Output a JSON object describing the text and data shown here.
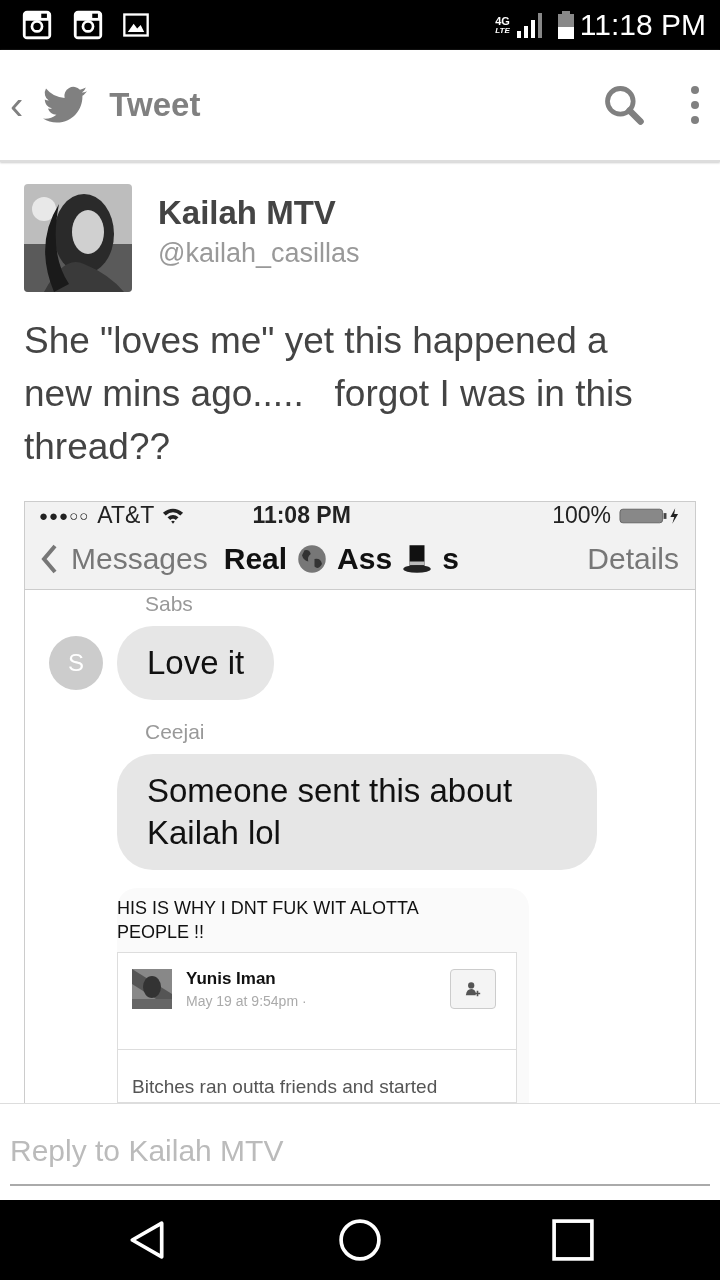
{
  "status_bar": {
    "network": "4G",
    "network_sub": "LTE",
    "time": "11:18 PM"
  },
  "toolbar": {
    "back": "‹",
    "title": "Tweet"
  },
  "tweet": {
    "name": "Kailah MTV",
    "handle": "@kailah_casillas",
    "text": "She \"loves me\" yet this happened a new mins ago.....   forgot I was in this thread??",
    "screenshot": {
      "status": {
        "signal": "●●●○○",
        "carrier": "AT&T",
        "time": "11:08 PM",
        "battery": "100%"
      },
      "nav": {
        "back": "Messages",
        "title_parts": [
          "Real",
          "Ass",
          "s"
        ],
        "details": "Details"
      },
      "messages": [
        {
          "sender": "Sabs",
          "avatar": true,
          "initial": "S",
          "text": "Love it"
        },
        {
          "sender": "Ceejai",
          "avatar": false,
          "text": "Someone sent this about Kailah lol"
        }
      ],
      "post": {
        "caption": "HIS IS WHY I DNT FUK WIT ALOTTA PEOPLE !!",
        "author": "Yunis Iman",
        "meta": "May 19 at 9:54pm ·",
        "body": "Bitches ran outta friends and started"
      }
    }
  },
  "reply": {
    "placeholder": "Reply to Kailah MTV"
  }
}
